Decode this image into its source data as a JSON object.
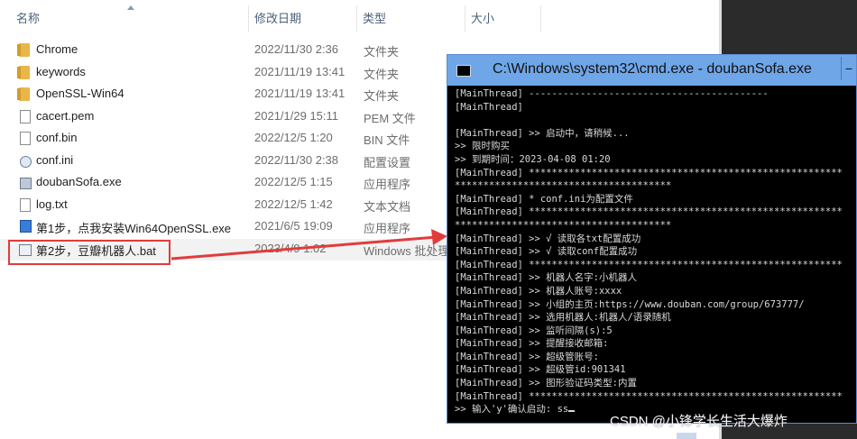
{
  "explorer": {
    "columns": {
      "name": "名称",
      "date": "修改日期",
      "type": "类型",
      "size": "大小"
    },
    "files": [
      {
        "name": "Chrome",
        "date": "2022/11/30 2:36",
        "type": "文件夹",
        "icon": "folder-icon"
      },
      {
        "name": "keywords",
        "date": "2021/11/19 13:41",
        "type": "文件夹",
        "icon": "folder-icon"
      },
      {
        "name": "OpenSSL-Win64",
        "date": "2021/11/19 13:41",
        "type": "文件夹",
        "icon": "folder-icon"
      },
      {
        "name": "cacert.pem",
        "date": "2021/1/29 15:11",
        "type": "PEM 文件",
        "icon": "file-icon"
      },
      {
        "name": "conf.bin",
        "date": "2022/12/5 1:20",
        "type": "BIN 文件",
        "icon": "file-icon"
      },
      {
        "name": "conf.ini",
        "date": "2022/11/30 2:38",
        "type": "配置设置",
        "icon": "config-file-icon"
      },
      {
        "name": "doubanSofa.exe",
        "date": "2022/12/5 1:15",
        "type": "应用程序",
        "icon": "exe-icon"
      },
      {
        "name": "log.txt",
        "date": "2022/12/5 1:42",
        "type": "文本文档",
        "icon": "text-file-icon"
      },
      {
        "name": "第1步，点我安装Win64OpenSSL.exe",
        "date": "2021/6/5 19:09",
        "type": "应用程序",
        "icon": "installer-icon"
      },
      {
        "name": "第2步，豆瓣机器人.bat",
        "date": "2023/4/9 1:02",
        "type": "Windows 批处理",
        "icon": "batch-file-icon"
      }
    ]
  },
  "cmd": {
    "title": "C:\\Windows\\system32\\cmd.exe - doubanSofa.exe",
    "lines": [
      "[MainThread] ------------------------------------------",
      "[MainThread]",
      "",
      "[MainThread] >> 启动中，请稍候...",
      ">> 限时购买",
      ">> 到期时间：2023-04-08 01:20",
      "[MainThread] *******************************************************",
      "**************************************",
      "[MainThread] * conf.ini为配置文件",
      "[MainThread] *******************************************************",
      "**************************************",
      "[MainThread] >> √ 读取各txt配置成功",
      "[MainThread] >> √ 读取conf配置成功",
      "[MainThread] *******************************************************",
      "[MainThread] >> 机器人名字:小机器人",
      "[MainThread] >> 机器人账号:xxxx",
      "[MainThread] >> 小组的主页:https://www.douban.com/group/673777/",
      "[MainThread] >> 选用机器人:机器人/语录随机",
      "[MainThread] >> 监听间隔(s):5",
      "[MainThread] >> 提醒接收邮箱:",
      "[MainThread] >> 超级管账号:",
      "[MainThread] >> 超级管id:901341",
      "[MainThread] >> 图形验证码类型:内置",
      "[MainThread] *******************************************************",
      ">> 输入'y'确认启动: ss"
    ]
  },
  "watermark": "CSDN @小锋学长生活大爆炸",
  "colors": {
    "highlight": "#e03c3c",
    "cmd_titlebar": "#6fa6e8",
    "console_bg": "#000000"
  }
}
